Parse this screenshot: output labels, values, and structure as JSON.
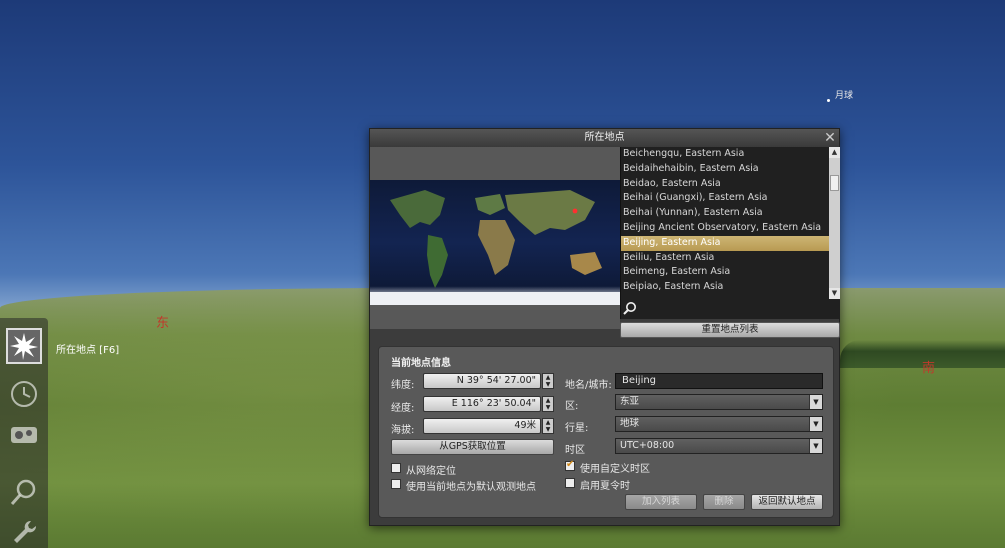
{
  "sky": {
    "moon_label": "月球",
    "cardinal_east": "东",
    "cardinal_south": "南"
  },
  "toolbar": {
    "tooltip": "所在地点 [F6]"
  },
  "dialog": {
    "title": "所在地点",
    "close_glyph": "✕",
    "locations": [
      "Beichengqu, Eastern Asia",
      "Beidaihehaibin, Eastern Asia",
      "Beidao, Eastern Asia",
      "Beihai (Guangxi), Eastern Asia",
      "Beihai (Yunnan), Eastern Asia",
      "Beijing Ancient Observatory, Eastern Asia",
      "Beijing, Eastern Asia",
      "Beiliu, Eastern Asia",
      "Beimeng, Eastern Asia",
      "Beipiao, Eastern Asia"
    ],
    "selected_index": 6,
    "search_placeholder": "",
    "reset_list_label": "重置地点列表",
    "info": {
      "section_title": "当前地点信息",
      "latitude_label": "纬度:",
      "latitude_value": "N 39° 54' 27.00\"",
      "longitude_label": "经度:",
      "longitude_value": "E 116° 23' 50.04\"",
      "altitude_label": "海拔:",
      "altitude_value": "49米",
      "gps_button": "从GPS获取位置",
      "network_locate": "从网络定位",
      "use_as_default": "使用当前地点为默认观测地点",
      "city_label": "地名/城市:",
      "city_value": "Beijing",
      "region_label": "区:",
      "region_value": "东亚",
      "planet_label": "行星:",
      "planet_value": "地球",
      "timezone_label": "时区",
      "timezone_value": "UTC+08:00",
      "custom_timezone": "使用自定义时区",
      "custom_timezone_checked": true,
      "dst": "启用夏令时",
      "add_list_button": "加入列表",
      "delete_button": "删除",
      "return_default_button": "返回默认地点"
    }
  }
}
